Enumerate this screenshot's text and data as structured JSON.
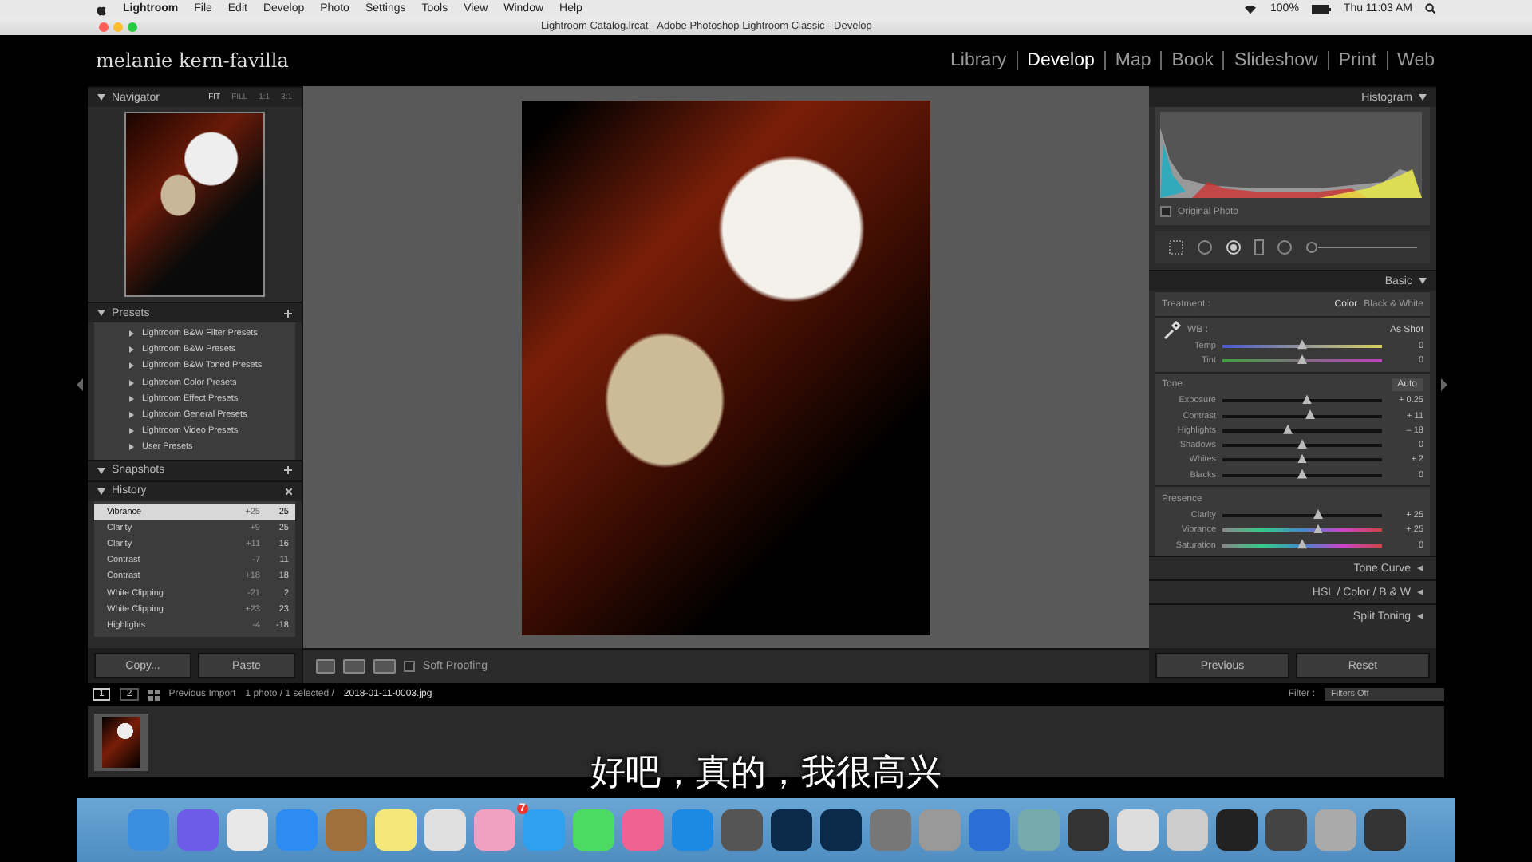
{
  "menubar": {
    "app": "Lightroom",
    "menus": [
      "File",
      "Edit",
      "Develop",
      "Photo",
      "Settings",
      "Tools",
      "View",
      "Window",
      "Help"
    ],
    "battery": "100%",
    "clock": "Thu 11:03 AM"
  },
  "window": {
    "title": "Lightroom Catalog.lrcat - Adobe Photoshop Lightroom Classic - Develop"
  },
  "identity_plate": "melanie kern-favilla",
  "modules": [
    {
      "label": "Library",
      "selected": false
    },
    {
      "label": "Develop",
      "selected": true
    },
    {
      "label": "Map",
      "selected": false
    },
    {
      "label": "Book",
      "selected": false
    },
    {
      "label": "Slideshow",
      "selected": false
    },
    {
      "label": "Print",
      "selected": false
    },
    {
      "label": "Web",
      "selected": false
    }
  ],
  "navigator": {
    "title": "Navigator",
    "zoom": [
      {
        "label": "FIT",
        "selected": true
      },
      {
        "label": "FILL",
        "selected": false
      },
      {
        "label": "1:1",
        "selected": false
      },
      {
        "label": "3:1",
        "selected": false
      }
    ]
  },
  "presets": {
    "title": "Presets",
    "items": [
      "Lightroom B&W Filter Presets",
      "Lightroom B&W Presets",
      "Lightroom B&W Toned Presets",
      "Lightroom Color Presets",
      "Lightroom Effect Presets",
      "Lightroom General Presets",
      "Lightroom Video Presets",
      "User Presets"
    ]
  },
  "snapshots": {
    "title": "Snapshots"
  },
  "history": {
    "title": "History",
    "items": [
      {
        "name": "Vibrance",
        "change": "+25",
        "value": "25",
        "selected": true
      },
      {
        "name": "Clarity",
        "change": "+9",
        "value": "25",
        "selected": false
      },
      {
        "name": "Clarity",
        "change": "+11",
        "value": "16",
        "selected": false
      },
      {
        "name": "Contrast",
        "change": "-7",
        "value": "11",
        "selected": false
      },
      {
        "name": "Contrast",
        "change": "+18",
        "value": "18",
        "selected": false
      },
      {
        "name": "White Clipping",
        "change": "-21",
        "value": "2",
        "selected": false
      },
      {
        "name": "White Clipping",
        "change": "+23",
        "value": "23",
        "selected": false
      },
      {
        "name": "Highlights",
        "change": "-4",
        "value": "-18",
        "selected": false
      }
    ]
  },
  "left_buttons": [
    "Copy...",
    "Paste"
  ],
  "toolbar": {
    "soft_proofing": {
      "label": "Soft Proofing",
      "checked": false
    }
  },
  "histogram": {
    "title": "Histogram",
    "original_photo": {
      "label": "Original Photo",
      "checked": false
    }
  },
  "basic": {
    "title": "Basic",
    "treatment_label": "Treatment :",
    "treatments": [
      {
        "label": "Color",
        "selected": true
      },
      {
        "label": "Black & White",
        "selected": false
      }
    ],
    "wb_label": "WB :",
    "wb_value": "As Shot",
    "groups": [
      {
        "sliders": [
          {
            "label": "Temp",
            "kind": "temp",
            "level": 0.5,
            "reading": "0"
          },
          {
            "label": "Tint",
            "kind": "tint",
            "level": 0.5,
            "reading": "0"
          }
        ]
      },
      {
        "title": "Tone",
        "button": "Auto",
        "sliders": [
          {
            "label": "Exposure",
            "kind": "plain",
            "level": 0.53,
            "reading": "+ 0.25"
          },
          {
            "label": "Contrast",
            "kind": "plain",
            "level": 0.55,
            "reading": "+ 11"
          },
          {
            "label": "Highlights",
            "kind": "plain",
            "level": 0.41,
            "reading": "– 18"
          },
          {
            "label": "Shadows",
            "kind": "plain",
            "level": 0.5,
            "reading": "0"
          },
          {
            "label": "Whites",
            "kind": "plain",
            "level": 0.5,
            "reading": "+ 2"
          },
          {
            "label": "Blacks",
            "kind": "plain",
            "level": 0.5,
            "reading": "0"
          }
        ]
      },
      {
        "title": "Presence",
        "sliders": [
          {
            "label": "Clarity",
            "kind": "plain",
            "level": 0.6,
            "reading": "+ 25"
          },
          {
            "label": "Vibrance",
            "kind": "color",
            "level": 0.6,
            "reading": "+ 25"
          },
          {
            "label": "Saturation",
            "kind": "color",
            "level": 0.5,
            "reading": "0"
          }
        ]
      }
    ]
  },
  "collapsed_panels": [
    "Tone Curve",
    "HSL  /  Color  /  B & W",
    "Split Toning"
  ],
  "right_buttons": [
    "Previous",
    "Reset"
  ],
  "filmstrip": {
    "pages": [
      {
        "label": "1",
        "selected": true
      },
      {
        "label": "2",
        "selected": false
      }
    ],
    "source": "Previous Import",
    "info": "1 photo / 1 selected /",
    "filename": "2018-01-11-0003.jpg",
    "filter_label": "Filter :",
    "filter_value": "Filters Off"
  },
  "subtitle": "好吧，真的，我很高兴",
  "dock": {
    "badge": "7"
  }
}
